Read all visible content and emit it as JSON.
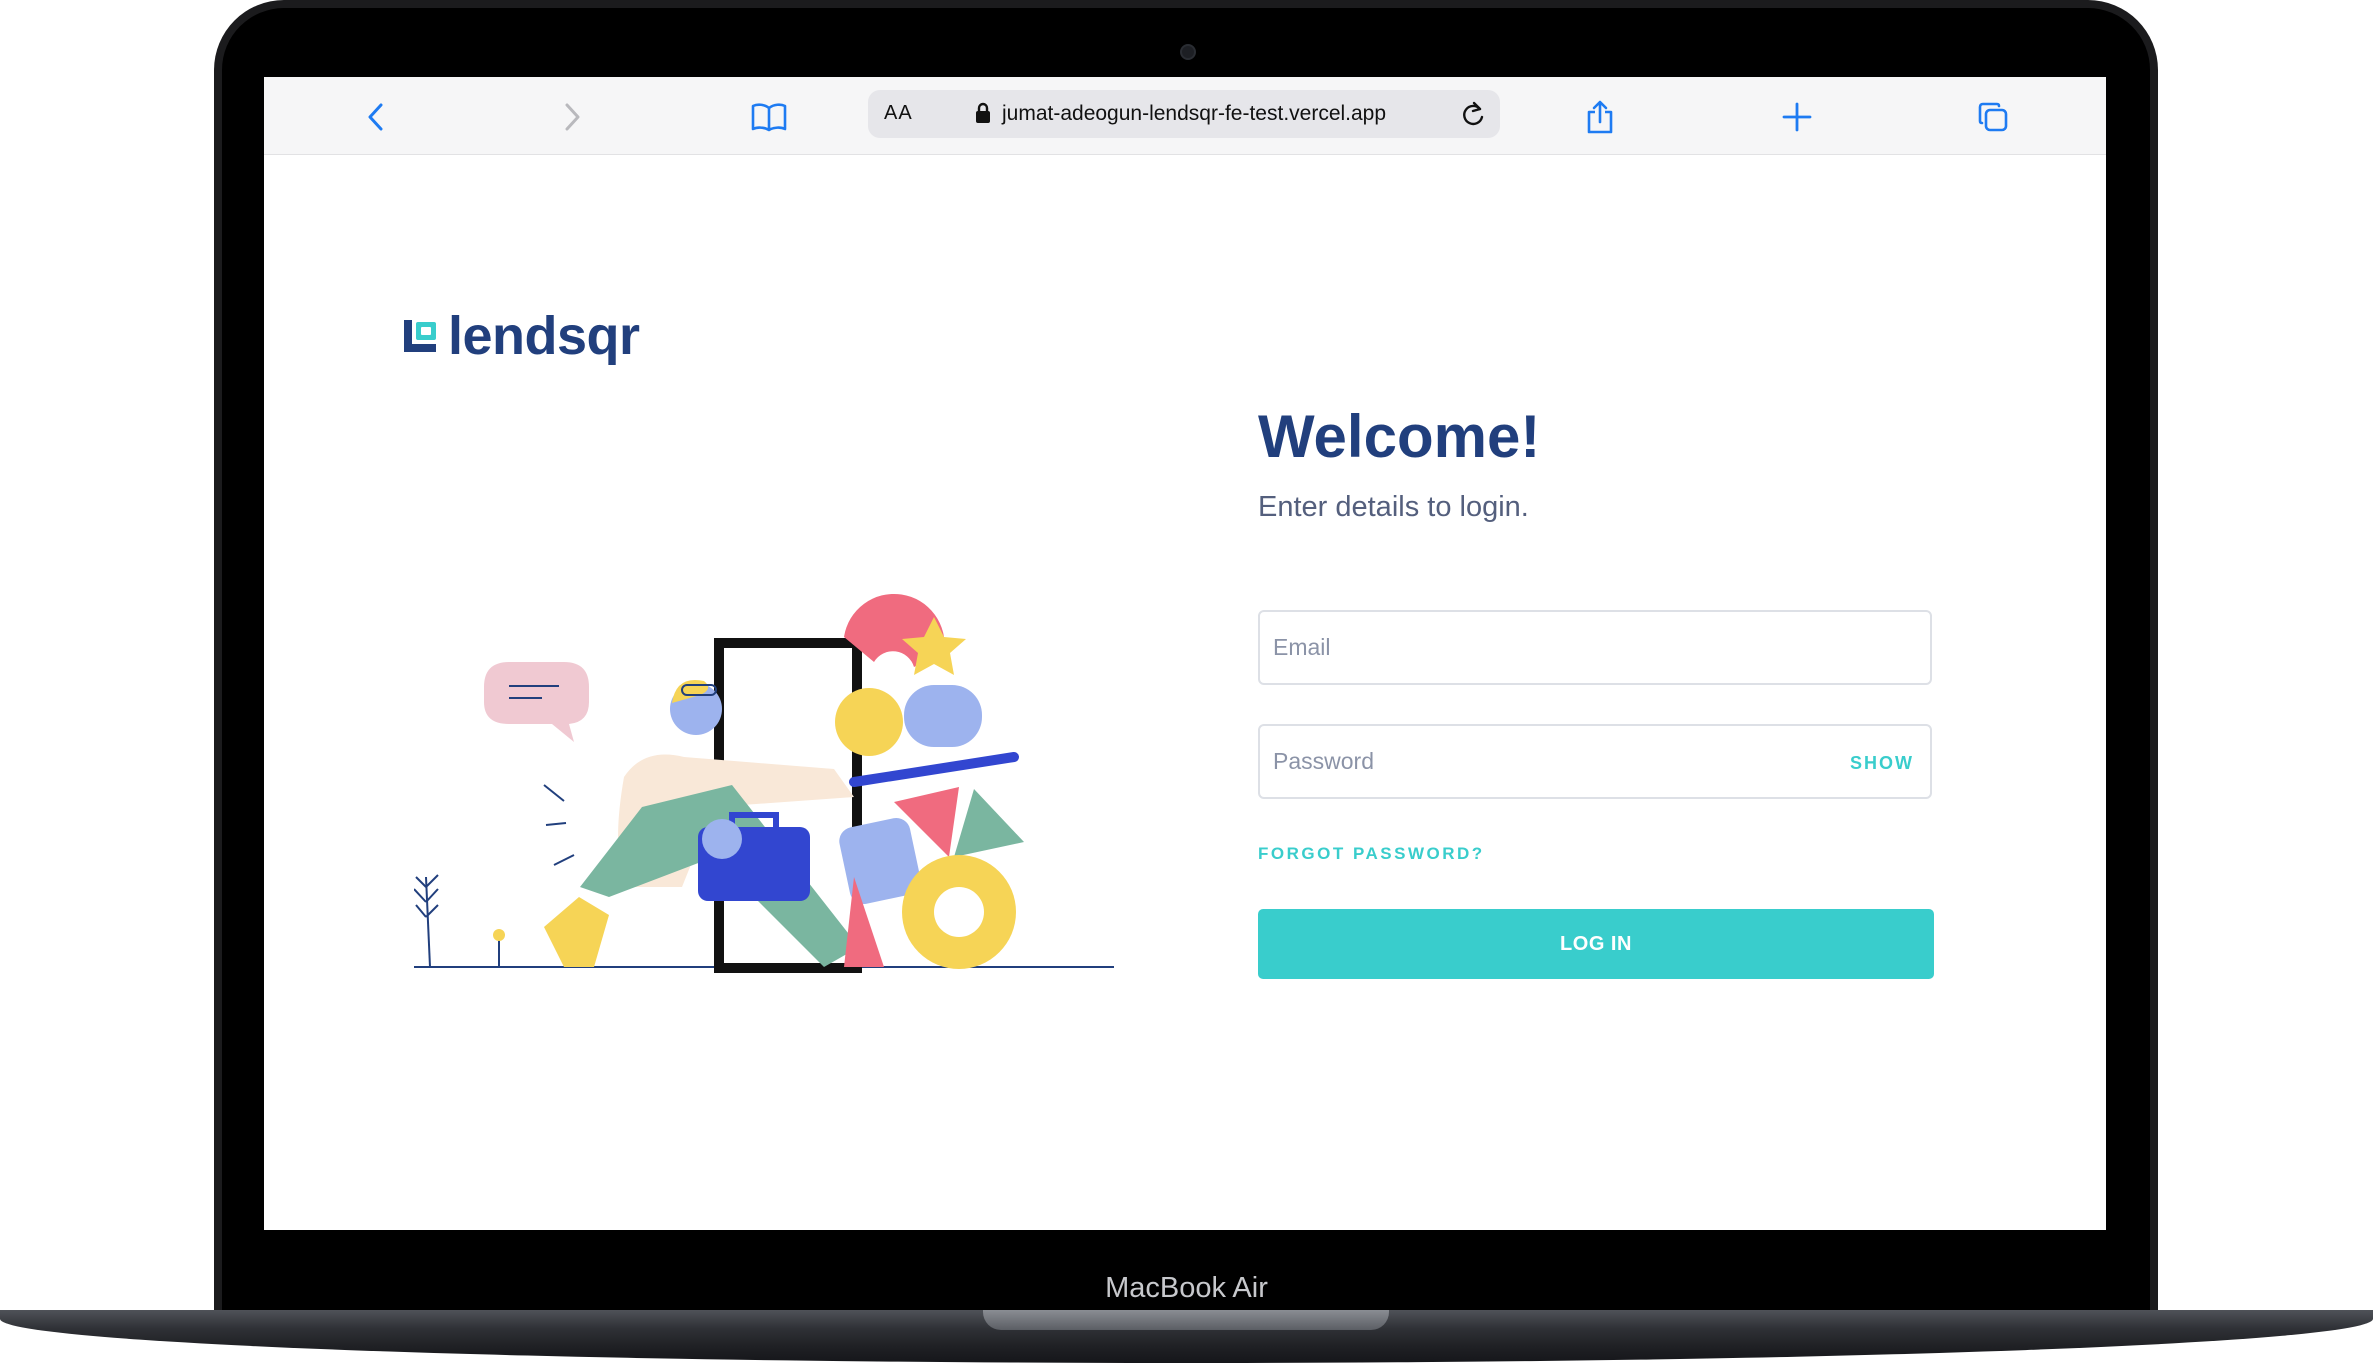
{
  "device": {
    "label": "MacBook Air"
  },
  "browser": {
    "text_size_label": "AA",
    "url": "jumat-adeogun-lendsqr-fe-test.vercel.app",
    "icons": [
      "back-icon",
      "forward-icon",
      "bookmarks-icon",
      "lock-icon",
      "reload-icon",
      "share-icon",
      "new-tab-icon",
      "tabs-icon"
    ]
  },
  "page": {
    "logo_text": "lendsqr",
    "title": "Welcome!",
    "subtitle": "Enter details to login.",
    "email": {
      "placeholder": "Email",
      "value": ""
    },
    "password": {
      "placeholder": "Password",
      "value": "",
      "toggle_label": "SHOW"
    },
    "forgot_label": "FORGOT PASSWORD?",
    "login_label": "LOG IN"
  },
  "colors": {
    "brand_navy": "#213F7D",
    "brand_teal": "#39CDCC",
    "text_secondary": "#545F7D",
    "ios_blue": "#1E7BF2"
  }
}
